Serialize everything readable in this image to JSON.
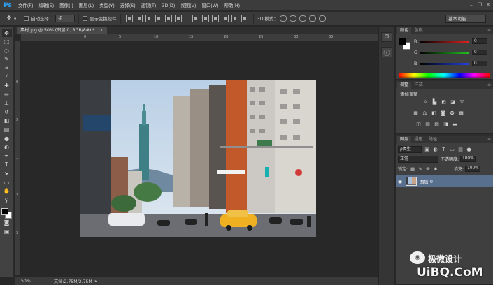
{
  "app": {
    "logo": "Ps"
  },
  "menu": {
    "items": [
      "文件(F)",
      "编辑(E)",
      "图像(I)",
      "图层(L)",
      "类型(Y)",
      "选择(S)",
      "滤镜(T)",
      "3D(D)",
      "视图(V)",
      "窗口(W)",
      "帮助(H)"
    ]
  },
  "window_controls": {
    "minimize": "–",
    "restore": "❐",
    "close": "✕"
  },
  "options": {
    "auto_select_label": "自动选择：",
    "auto_select_value": "组",
    "show_transform_label": "显示变换控件",
    "mode_label": "3D 模式：",
    "workspace": "基本功能"
  },
  "document": {
    "tab_title": "素材.jpg @ 50% (图层 0, RGB/8#) *",
    "close": "×"
  },
  "rulers": {
    "top_ticks": [
      "0",
      "5",
      "10",
      "15",
      "20",
      "25",
      "30",
      "35"
    ],
    "left_ticks": [
      "0",
      "5",
      "1",
      "2",
      "3"
    ]
  },
  "status": {
    "zoom": "50%",
    "doc_size": "文档:2.75M/2.75M",
    "arrow": "▸"
  },
  "tools": {
    "icons": [
      "move-icon",
      "marquee-icon",
      "lasso-icon",
      "quick-select-icon",
      "crop-icon",
      "eyedropper-icon",
      "healing-icon",
      "brush-icon",
      "stamp-icon",
      "history-brush-icon",
      "eraser-icon",
      "gradient-icon",
      "blur-icon",
      "dodge-icon",
      "pen-icon",
      "type-icon",
      "path-select-icon",
      "shape-icon",
      "hand-icon",
      "zoom-icon"
    ]
  },
  "panels": {
    "color": {
      "tabs": [
        "颜色",
        "色板"
      ],
      "sliders": [
        {
          "label": "R",
          "value": "0",
          "color": "#e02020"
        },
        {
          "label": "G",
          "value": "0",
          "color": "#20c020"
        },
        {
          "label": "B",
          "value": "0",
          "color": "#2040e0"
        }
      ]
    },
    "adjustments": {
      "tabs": [
        "调整",
        "样式"
      ],
      "title": "添加调整"
    },
    "layers": {
      "tabs": [
        "图层",
        "通道",
        "路径"
      ],
      "filter_type": "ρ类型",
      "blend_mode": "正常",
      "opacity_label": "不透明度:",
      "opacity_value": "100%",
      "lock_label": "锁定:",
      "fill_label": "填充:",
      "fill_value": "100%",
      "layer_name": "图层 0"
    }
  },
  "watermark": {
    "text": "极微设计",
    "site": "UiBQ.CoM"
  }
}
